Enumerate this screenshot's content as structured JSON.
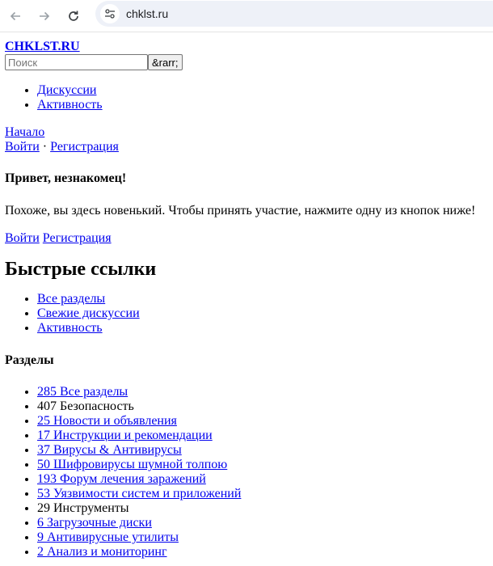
{
  "browser": {
    "url": "chklst.ru"
  },
  "header": {
    "site_title": "CHKLST.RU",
    "search_placeholder": "Поиск",
    "search_button": "&rarr;"
  },
  "top_nav": [
    {
      "label": "Дискуссии"
    },
    {
      "label": "Активность"
    }
  ],
  "crumbs": {
    "home": "Начало",
    "login": "Войти",
    "separator": "·",
    "register": "Регистрация"
  },
  "guest": {
    "heading": "Привет, незнакомец!",
    "message": "Похоже, вы здесь новенький. Чтобы принять участие, нажмите одну из кнопок ниже!",
    "login": "Войти",
    "register": "Регистрация"
  },
  "quick_links": {
    "heading": "Быстрые ссылки",
    "items": [
      {
        "label": "Все разделы"
      },
      {
        "label": "Свежие дискуссии"
      },
      {
        "label": "Активность"
      }
    ]
  },
  "sections": {
    "heading": "Разделы",
    "items": [
      {
        "label": "285 Все разделы",
        "link": true
      },
      {
        "label": "407 Безопасность",
        "link": false
      },
      {
        "label": "25 Новости и объявления",
        "link": true
      },
      {
        "label": "17 Инструкции и рекомендации",
        "link": true
      },
      {
        "label": "37 Вирусы & Антивирусы",
        "link": true
      },
      {
        "label": "50 Шифровирусы шумной толпою",
        "link": true
      },
      {
        "label": "193 Форум лечения заражений",
        "link": true
      },
      {
        "label": "53 Уязвимости систем и приложений",
        "link": true
      },
      {
        "label": "29 Инструменты",
        "link": false
      },
      {
        "label": "6 Загрузочные диски",
        "link": true
      },
      {
        "label": "9 Антивирусные утилиты",
        "link": true
      },
      {
        "label": "2 Анализ и мониторинг",
        "link": true
      }
    ]
  }
}
